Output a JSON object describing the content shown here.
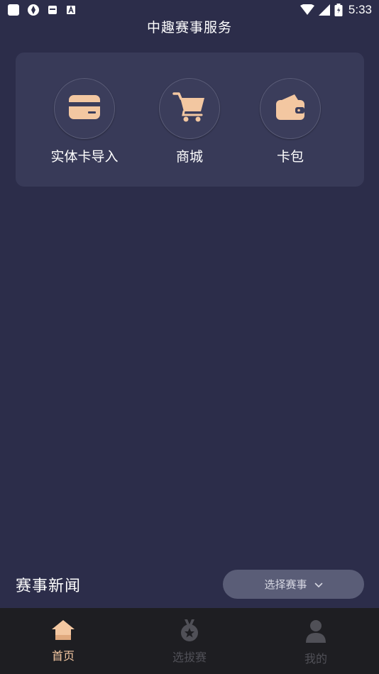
{
  "status_bar": {
    "time": "5:33"
  },
  "header": {
    "title": "中趣赛事服务"
  },
  "quick_entries": [
    {
      "label": "实体卡导入",
      "icon": "card-icon"
    },
    {
      "label": "商城",
      "icon": "cart-icon"
    },
    {
      "label": "卡包",
      "icon": "wallet-icon"
    }
  ],
  "news": {
    "title": "赛事新闻",
    "select_label": "选择赛事"
  },
  "tabbar": {
    "tabs": [
      {
        "label": "首页",
        "icon": "home-icon",
        "active": true
      },
      {
        "label": "选拔赛",
        "icon": "medal-icon",
        "active": false
      },
      {
        "label": "我的",
        "icon": "user-icon",
        "active": false
      }
    ]
  },
  "colors": {
    "background": "#2c2d4a",
    "card": "#383a58",
    "accent": "#f3c7a1",
    "tabbar": "#1e1e22"
  }
}
